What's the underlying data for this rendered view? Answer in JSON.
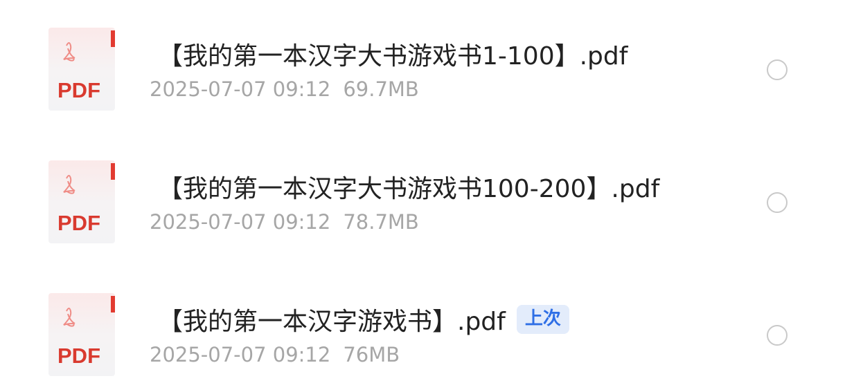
{
  "files": [
    {
      "icon_label": "PDF",
      "name": "【我的第一本汉字大书游戏书1-100】.pdf",
      "date": "2025-07-07 09:12",
      "size": "69.7MB",
      "badge": null
    },
    {
      "icon_label": "PDF",
      "name": "【我的第一本汉字大书游戏书100-200】.pdf",
      "date": "2025-07-07 09:12",
      "size": "78.7MB",
      "badge": null
    },
    {
      "icon_label": "PDF",
      "name": "【我的第一本汉字游戏书】.pdf",
      "date": "2025-07-07 09:12",
      "size": "76MB",
      "badge": "上次"
    }
  ],
  "colors": {
    "pdf_red": "#d93a2f",
    "badge_bg": "#e3ecfb",
    "badge_text": "#2f6fe6",
    "meta_gray": "#a6a6a6",
    "radio_border": "#c9c9c9"
  }
}
